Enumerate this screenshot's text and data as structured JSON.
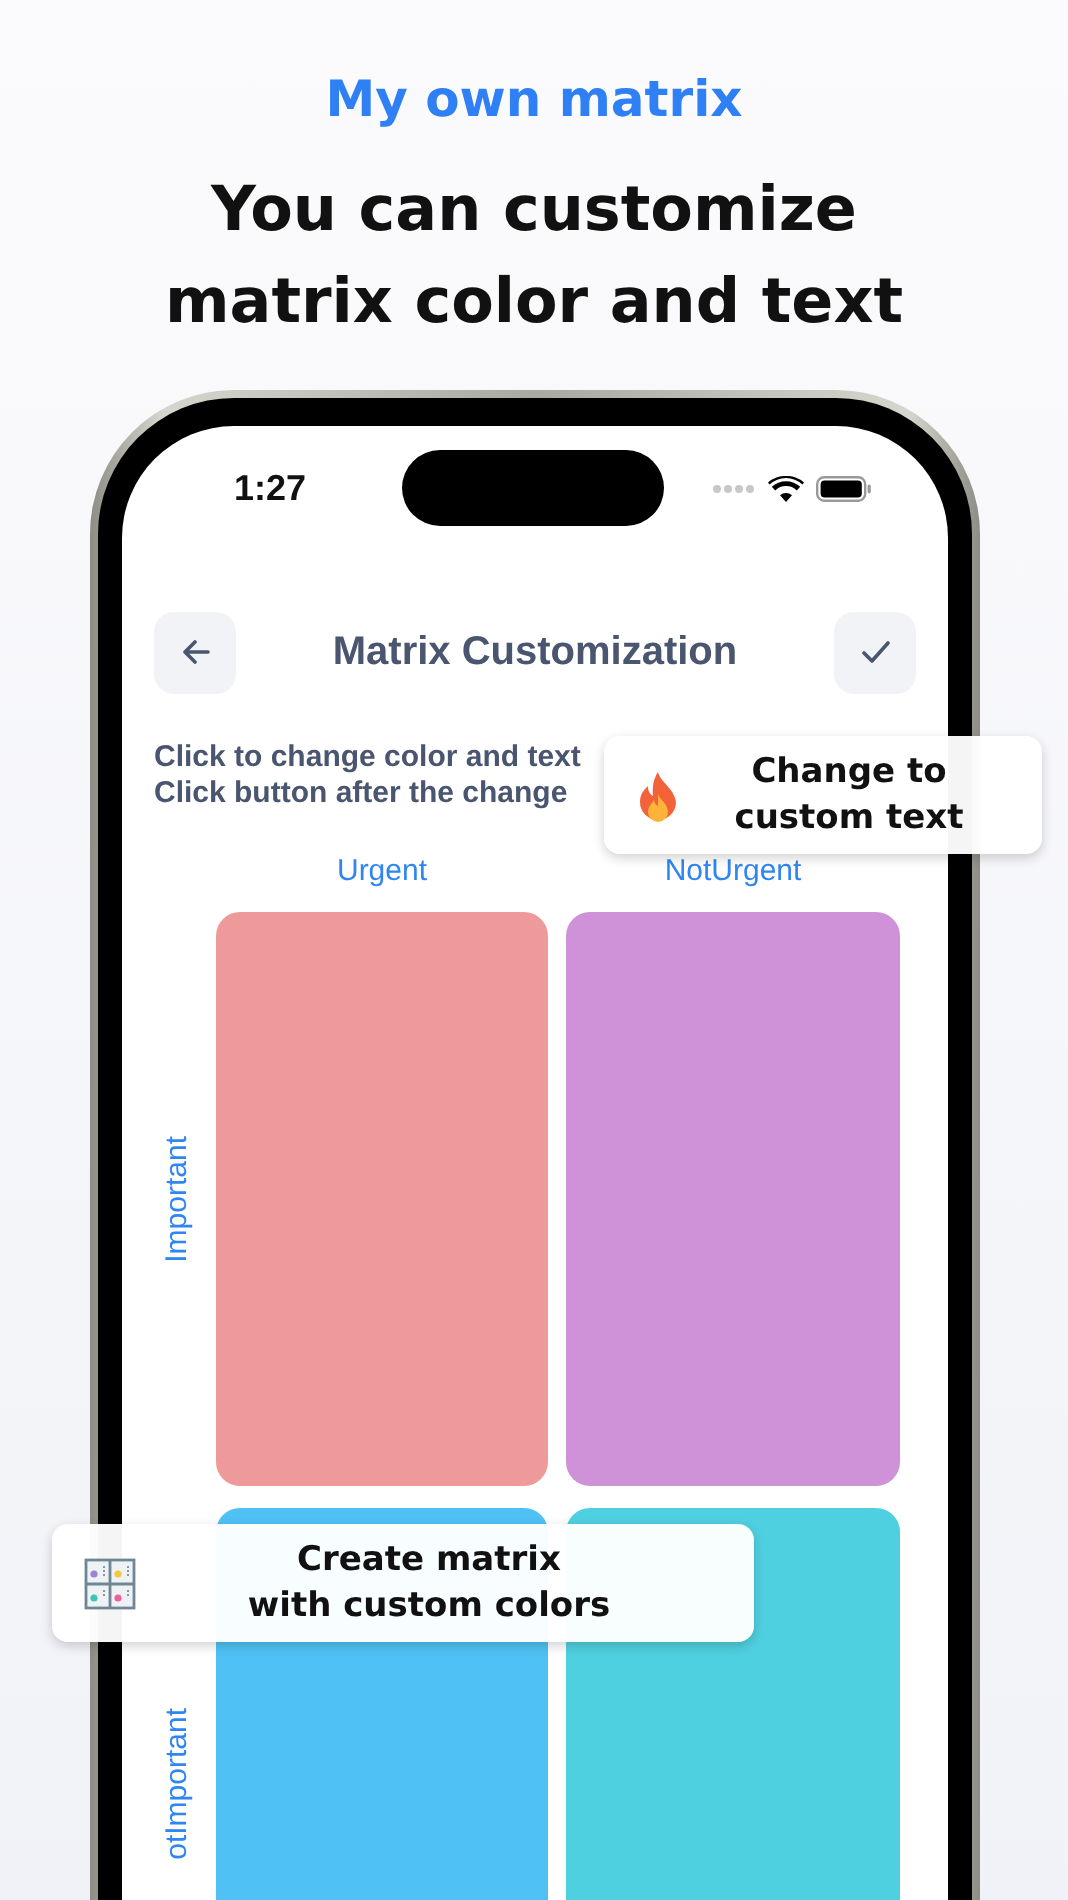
{
  "header": {
    "tagline": "My own matrix",
    "title": "You can customize matrix color and text"
  },
  "status_bar": {
    "time": "1:27"
  },
  "nav": {
    "title": "Matrix Customization"
  },
  "instructions": [
    "Click to change color and text",
    "Click button after the change"
  ],
  "columns": [
    "Urgent",
    "NotUrgent"
  ],
  "rows": [
    {
      "label": "Important",
      "cells": [
        {
          "color": "#ee9a9a"
        },
        {
          "color": "#cf92d9"
        }
      ]
    },
    {
      "label": "otImportant",
      "cells": [
        {
          "color": "#4fc1f5"
        },
        {
          "color": "#4fd0e0"
        }
      ]
    }
  ],
  "callouts": [
    {
      "kind": "flame",
      "lines": [
        "Change to",
        "custom text"
      ]
    },
    {
      "kind": "grid",
      "lines": [
        "Create matrix",
        "with custom colors"
      ]
    }
  ]
}
